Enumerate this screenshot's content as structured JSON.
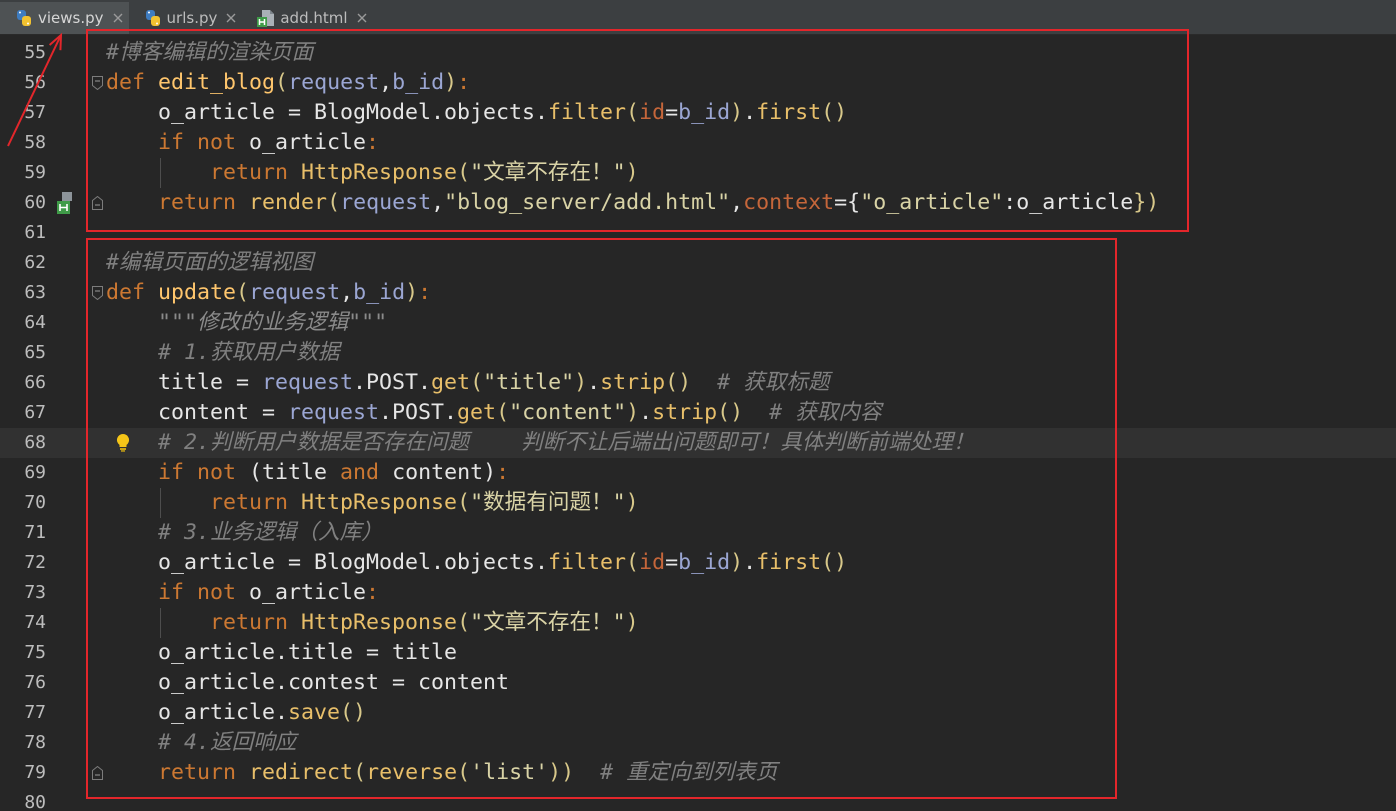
{
  "tabs": [
    {
      "label": "views.py",
      "icon": "python-file-icon",
      "active": true
    },
    {
      "label": "urls.py",
      "icon": "python-file-icon",
      "active": false
    },
    {
      "label": "add.html",
      "icon": "html-file-icon",
      "active": false
    }
  ],
  "annotation_color": "#e3262b",
  "editor": {
    "current_line": 68,
    "lines": [
      {
        "number": 55,
        "tokens": [
          [
            "#博客编辑的渲染页面",
            "#808080",
            true
          ]
        ]
      },
      {
        "number": 56,
        "gutter": [
          "fold-start-icon"
        ],
        "tokens": [
          [
            "def",
            "#cc7832"
          ],
          [
            " ",
            "#e6e6e6"
          ],
          [
            "edit_blog",
            "#ffc66d"
          ],
          [
            "(",
            "#d8c88a"
          ],
          [
            "request",
            "#9ba6d3"
          ],
          [
            ",",
            "#e6e6e6"
          ],
          [
            "b_id",
            "#9ba6d3"
          ],
          [
            ")",
            "#d8c88a"
          ],
          [
            ":",
            "#cc7832"
          ]
        ]
      },
      {
        "number": 57,
        "tokens": [
          [
            "    o_article = BlogModel.objects.",
            "#e6e6e6"
          ],
          [
            "filter",
            "#e8bf6a"
          ],
          [
            "(",
            "#d8c88a"
          ],
          [
            "id",
            "#c5663a"
          ],
          [
            "=",
            "#e6e6e6"
          ],
          [
            "b_id",
            "#9ba6d3"
          ],
          [
            ")",
            "#d8c88a"
          ],
          [
            ".",
            "#e6e6e6"
          ],
          [
            "first",
            "#e8bf6a"
          ],
          [
            "()",
            "#d8c88a"
          ]
        ]
      },
      {
        "number": 58,
        "tokens": [
          [
            "    ",
            "#e6e6e6"
          ],
          [
            "if not",
            "#cc7832"
          ],
          [
            " o_article",
            "#e6e6e6"
          ],
          [
            ":",
            "#cc7832"
          ]
        ]
      },
      {
        "number": 59,
        "tokens": [
          [
            "        ",
            "#e6e6e6"
          ],
          [
            "return",
            "#cc7832"
          ],
          [
            " ",
            "#e6e6e6"
          ],
          [
            "HttpResponse",
            "#e8bf6a"
          ],
          [
            "(",
            "#d8c88a"
          ],
          [
            "\"文章不存在！\"",
            "#d9d3a6"
          ],
          [
            ")",
            "#d8c88a"
          ]
        ]
      },
      {
        "number": 60,
        "gutter": [
          "html-template-icon",
          "fold-end-icon"
        ],
        "tokens": [
          [
            "    ",
            "#e6e6e6"
          ],
          [
            "return",
            "#cc7832"
          ],
          [
            " ",
            "#e6e6e6"
          ],
          [
            "render",
            "#e8bf6a"
          ],
          [
            "(",
            "#d8c88a"
          ],
          [
            "request",
            "#9ba6d3"
          ],
          [
            ",",
            "#e6e6e6"
          ],
          [
            "\"blog_server/add.html\"",
            "#d9d3a6"
          ],
          [
            ",",
            "#e6e6e6"
          ],
          [
            "context",
            "#c5663a"
          ],
          [
            "=",
            "#e6e6e6"
          ],
          [
            "{",
            "#e6e6e6"
          ],
          [
            "\"o_article\"",
            "#d9d3a6"
          ],
          [
            ":",
            "#e6e6e6"
          ],
          [
            "o_article",
            "#e6e6e6"
          ],
          [
            "})",
            "#d8c88a"
          ]
        ]
      },
      {
        "number": 61,
        "tokens": []
      },
      {
        "number": 62,
        "tokens": [
          [
            "#编辑页面的逻辑视图",
            "#808080",
            true
          ]
        ]
      },
      {
        "number": 63,
        "gutter": [
          "fold-start-icon"
        ],
        "tokens": [
          [
            "def",
            "#cc7832"
          ],
          [
            " ",
            "#e6e6e6"
          ],
          [
            "update",
            "#ffc66d"
          ],
          [
            "(",
            "#d8c88a"
          ],
          [
            "request",
            "#9ba6d3"
          ],
          [
            ",",
            "#e6e6e6"
          ],
          [
            "b_id",
            "#9ba6d3"
          ],
          [
            ")",
            "#d8c88a"
          ],
          [
            ":",
            "#cc7832"
          ]
        ]
      },
      {
        "number": 64,
        "tokens": [
          [
            "    ",
            "#e6e6e6"
          ],
          [
            "\"\"\"修改的业务逻辑\"\"\"",
            "#8a8a8a",
            true
          ]
        ]
      },
      {
        "number": 65,
        "tokens": [
          [
            "    ",
            "#e6e6e6"
          ],
          [
            "# 1.获取用户数据",
            "#808080",
            true
          ]
        ]
      },
      {
        "number": 66,
        "tokens": [
          [
            "    title = ",
            "#e6e6e6"
          ],
          [
            "request",
            "#9ba6d3"
          ],
          [
            ".POST.",
            "#e6e6e6"
          ],
          [
            "get",
            "#e8bf6a"
          ],
          [
            "(",
            "#d8c88a"
          ],
          [
            "\"title\"",
            "#d9d3a6"
          ],
          [
            ")",
            "#d8c88a"
          ],
          [
            ".",
            "#e6e6e6"
          ],
          [
            "strip",
            "#e8bf6a"
          ],
          [
            "()",
            "#d8c88a"
          ],
          [
            "  ",
            "#e6e6e6"
          ],
          [
            "# 获取标题",
            "#808080",
            true
          ]
        ]
      },
      {
        "number": 67,
        "tokens": [
          [
            "    content = ",
            "#e6e6e6"
          ],
          [
            "request",
            "#9ba6d3"
          ],
          [
            ".POST.",
            "#e6e6e6"
          ],
          [
            "get",
            "#e8bf6a"
          ],
          [
            "(",
            "#d8c88a"
          ],
          [
            "\"content\"",
            "#d9d3a6"
          ],
          [
            ")",
            "#d8c88a"
          ],
          [
            ".",
            "#e6e6e6"
          ],
          [
            "strip",
            "#e8bf6a"
          ],
          [
            "()",
            "#d8c88a"
          ],
          [
            "  ",
            "#e6e6e6"
          ],
          [
            "# 获取内容",
            "#808080",
            true
          ]
        ]
      },
      {
        "number": 68,
        "gutter": [
          "intention-bulb-icon"
        ],
        "tokens": [
          [
            "    ",
            "#e6e6e6"
          ],
          [
            "# 2.判断用户数据是否存在问题    判断不让后端出问题即可！具体判断前端处理！",
            "#808080",
            true
          ]
        ]
      },
      {
        "number": 69,
        "tokens": [
          [
            "    ",
            "#e6e6e6"
          ],
          [
            "if not",
            "#cc7832"
          ],
          [
            " (title ",
            "#e6e6e6"
          ],
          [
            "and",
            "#cc7832"
          ],
          [
            " content)",
            "#e6e6e6"
          ],
          [
            ":",
            "#cc7832"
          ]
        ]
      },
      {
        "number": 70,
        "tokens": [
          [
            "        ",
            "#e6e6e6"
          ],
          [
            "return",
            "#cc7832"
          ],
          [
            " ",
            "#e6e6e6"
          ],
          [
            "HttpResponse",
            "#e8bf6a"
          ],
          [
            "(",
            "#d8c88a"
          ],
          [
            "\"数据有问题！\"",
            "#d9d3a6"
          ],
          [
            ")",
            "#d8c88a"
          ]
        ]
      },
      {
        "number": 71,
        "tokens": [
          [
            "    ",
            "#e6e6e6"
          ],
          [
            "# 3.业务逻辑（入库）",
            "#808080",
            true
          ]
        ]
      },
      {
        "number": 72,
        "tokens": [
          [
            "    o_article = BlogModel.objects.",
            "#e6e6e6"
          ],
          [
            "filter",
            "#e8bf6a"
          ],
          [
            "(",
            "#d8c88a"
          ],
          [
            "id",
            "#c5663a"
          ],
          [
            "=",
            "#e6e6e6"
          ],
          [
            "b_id",
            "#9ba6d3"
          ],
          [
            ")",
            "#d8c88a"
          ],
          [
            ".",
            "#e6e6e6"
          ],
          [
            "first",
            "#e8bf6a"
          ],
          [
            "()",
            "#d8c88a"
          ]
        ]
      },
      {
        "number": 73,
        "tokens": [
          [
            "    ",
            "#e6e6e6"
          ],
          [
            "if not",
            "#cc7832"
          ],
          [
            " o_article",
            "#e6e6e6"
          ],
          [
            ":",
            "#cc7832"
          ]
        ]
      },
      {
        "number": 74,
        "tokens": [
          [
            "        ",
            "#e6e6e6"
          ],
          [
            "return",
            "#cc7832"
          ],
          [
            " ",
            "#e6e6e6"
          ],
          [
            "HttpResponse",
            "#e8bf6a"
          ],
          [
            "(",
            "#d8c88a"
          ],
          [
            "\"文章不存在！\"",
            "#d9d3a6"
          ],
          [
            ")",
            "#d8c88a"
          ]
        ]
      },
      {
        "number": 75,
        "tokens": [
          [
            "    o_article.title = title",
            "#e6e6e6"
          ]
        ]
      },
      {
        "number": 76,
        "tokens": [
          [
            "    o_article.contest = content",
            "#e6e6e6"
          ]
        ]
      },
      {
        "number": 77,
        "tokens": [
          [
            "    o_article.",
            "#e6e6e6"
          ],
          [
            "save",
            "#e8bf6a"
          ],
          [
            "()",
            "#d8c88a"
          ]
        ]
      },
      {
        "number": 78,
        "tokens": [
          [
            "    ",
            "#e6e6e6"
          ],
          [
            "# 4.返回响应",
            "#808080",
            true
          ]
        ]
      },
      {
        "number": 79,
        "gutter": [
          "fold-end-icon"
        ],
        "tokens": [
          [
            "    ",
            "#e6e6e6"
          ],
          [
            "return",
            "#cc7832"
          ],
          [
            " ",
            "#e6e6e6"
          ],
          [
            "redirect",
            "#e8bf6a"
          ],
          [
            "(",
            "#d8c88a"
          ],
          [
            "reverse",
            "#e8bf6a"
          ],
          [
            "(",
            "#d8c88a"
          ],
          [
            "'list'",
            "#d9d3a6"
          ],
          [
            "))",
            "#d8c88a"
          ],
          [
            "  ",
            "#e6e6e6"
          ],
          [
            "# 重定向到列表页",
            "#808080",
            true
          ]
        ]
      },
      {
        "number": 80,
        "tokens": []
      }
    ]
  }
}
